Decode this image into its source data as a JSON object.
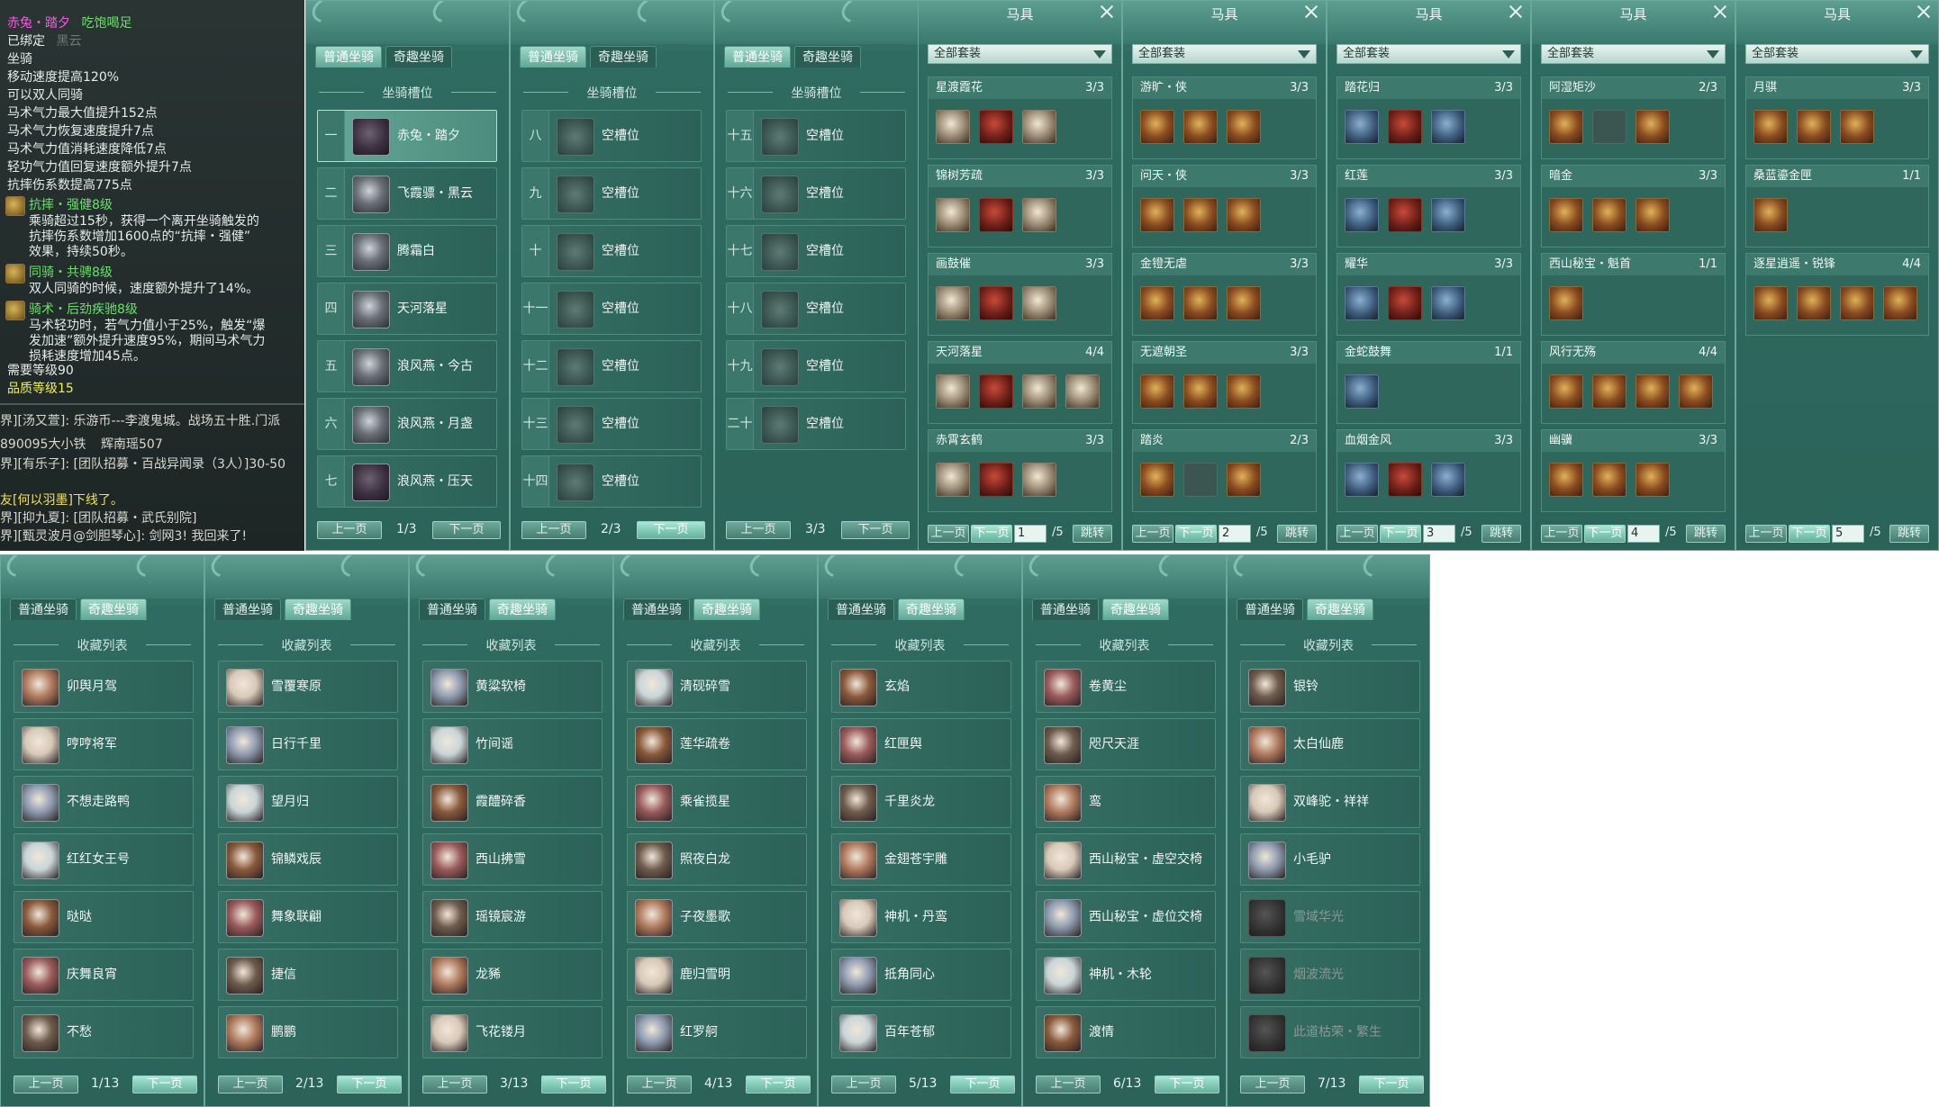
{
  "tooltip": {
    "mount_name": "赤兔・踏夕",
    "status": "吃饱喝足",
    "bound": "已绑定",
    "bound_extra": "黑云",
    "category": "坐骑",
    "stats": [
      "移动速度提高120%",
      "可以双人同骑",
      "马术气力最大值提升152点",
      "马术气力恢复速度提升7点",
      "马术气力值消耗速度降低7点",
      "轻功气力值回复速度额外提升7点",
      "抗摔伤系数提高775点"
    ],
    "skills": [
      {
        "title": "抗摔・强健8级",
        "desc": [
          "乘骑超过15秒，获得一个离开坐骑触发的",
          "抗摔伤系数增加1600点的“抗摔・强健”",
          "效果，持续50秒。"
        ]
      },
      {
        "title": "同骑・共骋8级",
        "desc": [
          "双人同骑的时候，速度额外提升了14%。"
        ]
      },
      {
        "title": "骑术・后劲疾驰8级",
        "desc": [
          "马术轻功时，若气力值小于25%，触发“爆",
          "发加速”额外提升速度95%，期间马术气力",
          "损耗速度增加45点。"
        ]
      }
    ],
    "req_level": "需要等级90",
    "quality_level": "品质等级15",
    "chat": [
      "界][汤又萱]: 乐游币---李渡鬼城。战场五十胜.门派",
      "890095大小铁",
      "辉南瑶507",
      "界][有乐子]: [团队招募・百战异闻录（3人）]30-50",
      "友[何以羽墨]下线了。",
      "界][抑九夏]: [团队招募・武氏别院]",
      "界][甄灵波月@剑胆琴心]: 剑网3! 我回来了!"
    ]
  },
  "slot_panels": [
    {
      "tabs": [
        "普通坐骑",
        "奇趣坐骑"
      ],
      "section": "坐骑槽位",
      "page": "1/3",
      "prev": "上一页",
      "next": "下一页",
      "slots": [
        {
          "num": "一",
          "name": "赤兔・踏夕",
          "icon": "horse-icon"
        },
        {
          "num": "二",
          "name": "飞霞骠・黑云",
          "icon": "horse-icon"
        },
        {
          "num": "三",
          "name": "腾霜白",
          "icon": "horse-icon"
        },
        {
          "num": "四",
          "name": "天河落星",
          "icon": "horse-icon"
        },
        {
          "num": "五",
          "name": "浪风燕・今古",
          "icon": "horse-icon"
        },
        {
          "num": "六",
          "name": "浪风燕・月盏",
          "icon": "horse-icon"
        },
        {
          "num": "七",
          "name": "浪风燕・压天",
          "icon": "horse-icon"
        }
      ]
    },
    {
      "tabs": [
        "普通坐骑",
        "奇趣坐骑"
      ],
      "section": "坐骑槽位",
      "page": "2/3",
      "prev": "上一页",
      "next": "下一页",
      "slots": [
        {
          "num": "八",
          "name": "空槽位"
        },
        {
          "num": "九",
          "name": "空槽位"
        },
        {
          "num": "十",
          "name": "空槽位"
        },
        {
          "num": "十一",
          "name": "空槽位"
        },
        {
          "num": "十二",
          "name": "空槽位"
        },
        {
          "num": "十三",
          "name": "空槽位"
        },
        {
          "num": "十四",
          "name": "空槽位"
        }
      ]
    },
    {
      "tabs": [
        "普通坐骑",
        "奇趣坐骑"
      ],
      "section": "坐骑槽位",
      "page": "3/3",
      "prev": "上一页",
      "next": "下一页",
      "slots": [
        {
          "num": "十五",
          "name": "空槽位"
        },
        {
          "num": "十六",
          "name": "空槽位"
        },
        {
          "num": "十七",
          "name": "空槽位"
        },
        {
          "num": "十八",
          "name": "空槽位"
        },
        {
          "num": "十九",
          "name": "空槽位"
        },
        {
          "num": "二十",
          "name": "空槽位"
        }
      ]
    }
  ],
  "equip_panels": [
    {
      "title": "马具",
      "filter": "全部套装",
      "page": "1",
      "total": "/5",
      "prev": "上一页",
      "next": "下一页",
      "jump": "跳转",
      "sets": [
        {
          "name": "星渡霞花",
          "count": "3/3",
          "items": 3
        },
        {
          "name": "锦树芳疏",
          "count": "3/3",
          "items": 3
        },
        {
          "name": "画鼓催",
          "count": "3/3",
          "items": 3
        },
        {
          "name": "天河落星",
          "count": "4/4",
          "items": 4
        },
        {
          "name": "赤霄玄鹤",
          "count": "3/3",
          "items": 3
        }
      ]
    },
    {
      "title": "马具",
      "filter": "全部套装",
      "page": "2",
      "total": "/5",
      "prev": "上一页",
      "next": "下一页",
      "jump": "跳转",
      "sets": [
        {
          "name": "游旷・侠",
          "count": "3/3",
          "items": 3
        },
        {
          "name": "问天・侠",
          "count": "3/3",
          "items": 3
        },
        {
          "name": "金镫无虐",
          "count": "3/3",
          "items": 3
        },
        {
          "name": "无遮朝圣",
          "count": "3/3",
          "items": 3
        },
        {
          "name": "踏炎",
          "count": "2/3",
          "items": 3,
          "empty": 1
        }
      ]
    },
    {
      "title": "马具",
      "filter": "全部套装",
      "page": "3",
      "total": "/5",
      "prev": "上一页",
      "next": "下一页",
      "jump": "跳转",
      "sets": [
        {
          "name": "踏花归",
          "count": "3/3",
          "items": 3
        },
        {
          "name": "红莲",
          "count": "3/3",
          "items": 3
        },
        {
          "name": "耀华",
          "count": "3/3",
          "items": 3
        },
        {
          "name": "金蛇鼓舞",
          "count": "1/1",
          "items": 1
        },
        {
          "name": "血烟金风",
          "count": "3/3",
          "items": 3
        }
      ]
    },
    {
      "title": "马具",
      "filter": "全部套装",
      "page": "4",
      "total": "/5",
      "prev": "上一页",
      "next": "下一页",
      "jump": "跳转",
      "sets": [
        {
          "name": "阿湿矩沙",
          "count": "2/3",
          "items": 3,
          "empty": 1
        },
        {
          "name": "暗金",
          "count": "3/3",
          "items": 3
        },
        {
          "name": "西山秘宝・魁首",
          "count": "1/1",
          "items": 1
        },
        {
          "name": "风行无殇",
          "count": "4/4",
          "items": 4
        },
        {
          "name": "幽骥",
          "count": "3/3",
          "items": 3
        }
      ]
    },
    {
      "title": "马具",
      "filter": "全部套装",
      "page": "5",
      "total": "/5",
      "prev": "上一页",
      "next": "下一页",
      "jump": "跳转",
      "sets": [
        {
          "name": "月骐",
          "count": "3/3",
          "items": 3
        },
        {
          "name": "桑蓝鎏金匣",
          "count": "1/1",
          "items": 1
        },
        {
          "name": "逐星逍遥・锐锋",
          "count": "4/4",
          "items": 4
        }
      ]
    }
  ],
  "collection_panels": [
    {
      "tabs": [
        "普通坐骑",
        "奇趣坐骑"
      ],
      "section": "收藏列表",
      "page": "1/13",
      "prev": "上一页",
      "next": "下一页",
      "items": [
        "卯舆月驾",
        "哼哼将军",
        "不想走路鸭",
        "红红女王号",
        "哒哒",
        "庆舞良宵",
        "不愁"
      ]
    },
    {
      "tabs": [
        "普通坐骑",
        "奇趣坐骑"
      ],
      "section": "收藏列表",
      "page": "2/13",
      "prev": "上一页",
      "next": "下一页",
      "items": [
        "雪覆寒原",
        "日行千里",
        "望月归",
        "锦鳞戏辰",
        "舞象联翩",
        "捷信",
        "鹏鹏"
      ]
    },
    {
      "tabs": [
        "普通坐骑",
        "奇趣坐骑"
      ],
      "section": "收藏列表",
      "page": "3/13",
      "prev": "上一页",
      "next": "下一页",
      "items": [
        "黄粱软椅",
        "竹间谣",
        "霞醴碎香",
        "西山拂雪",
        "瑶镜宸游",
        "龙豨",
        "飞花镂月"
      ]
    },
    {
      "tabs": [
        "普通坐骑",
        "奇趣坐骑"
      ],
      "section": "收藏列表",
      "page": "4/13",
      "prev": "上一页",
      "next": "下一页",
      "items": [
        "清砚碎雪",
        "莲华疏卷",
        "乘雀揽星",
        "照夜白龙",
        "子夜墨歌",
        "鹿归雪明",
        "红罗舸"
      ]
    },
    {
      "tabs": [
        "普通坐骑",
        "奇趣坐骑"
      ],
      "section": "收藏列表",
      "page": "5/13",
      "prev": "上一页",
      "next": "下一页",
      "items": [
        "玄焰",
        "红匣舆",
        "千里炎龙",
        "金翅苍宇雕",
        "神机・丹鸾",
        "抵角同心",
        "百年苍郁"
      ]
    },
    {
      "tabs": [
        "普通坐骑",
        "奇趣坐骑"
      ],
      "section": "收藏列表",
      "page": "6/13",
      "prev": "上一页",
      "next": "下一页",
      "items": [
        "卷黄尘",
        "咫尺天涯",
        "鸾",
        "西山秘宝・虚空交椅",
        "西山秘宝・虚位交椅",
        "神机・木轮",
        "渡情"
      ]
    },
    {
      "tabs": [
        "普通坐骑",
        "奇趣坐骑"
      ],
      "section": "收藏列表",
      "page": "7/13",
      "prev": "上一页",
      "next": "下一页",
      "items": [
        "银铃",
        "太白仙鹿",
        "双峰驼・祥祥",
        "小毛驴",
        "雪域华光",
        "烟波流光",
        "此道枯荣・繁生"
      ],
      "dim_from": 4
    }
  ]
}
